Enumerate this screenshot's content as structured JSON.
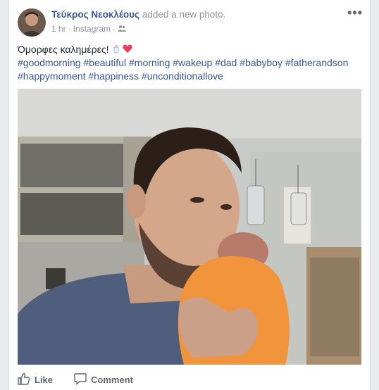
{
  "post": {
    "author": "Τεύκρος Νεοκλέους",
    "action_text": "added a new photo.",
    "time": "1 hr",
    "source": "Instagram",
    "privacy_icon": "friends-icon",
    "more_label": "•••",
    "caption": "Όμορφες καλημέρες!",
    "emoji": [
      "baby-bottle-icon",
      "heart-icon"
    ],
    "hashtags_line1": "#goodmorning #beautiful #morning #wakeup #dad #babyboy #fatherandson",
    "hashtags_line2": "#happymoment #happiness #unconditionallove"
  },
  "actions": {
    "like_label": "Like",
    "comment_label": "Comment"
  },
  "colors": {
    "link": "#365899",
    "meta": "#90949c",
    "heart": "#e83e5c"
  }
}
